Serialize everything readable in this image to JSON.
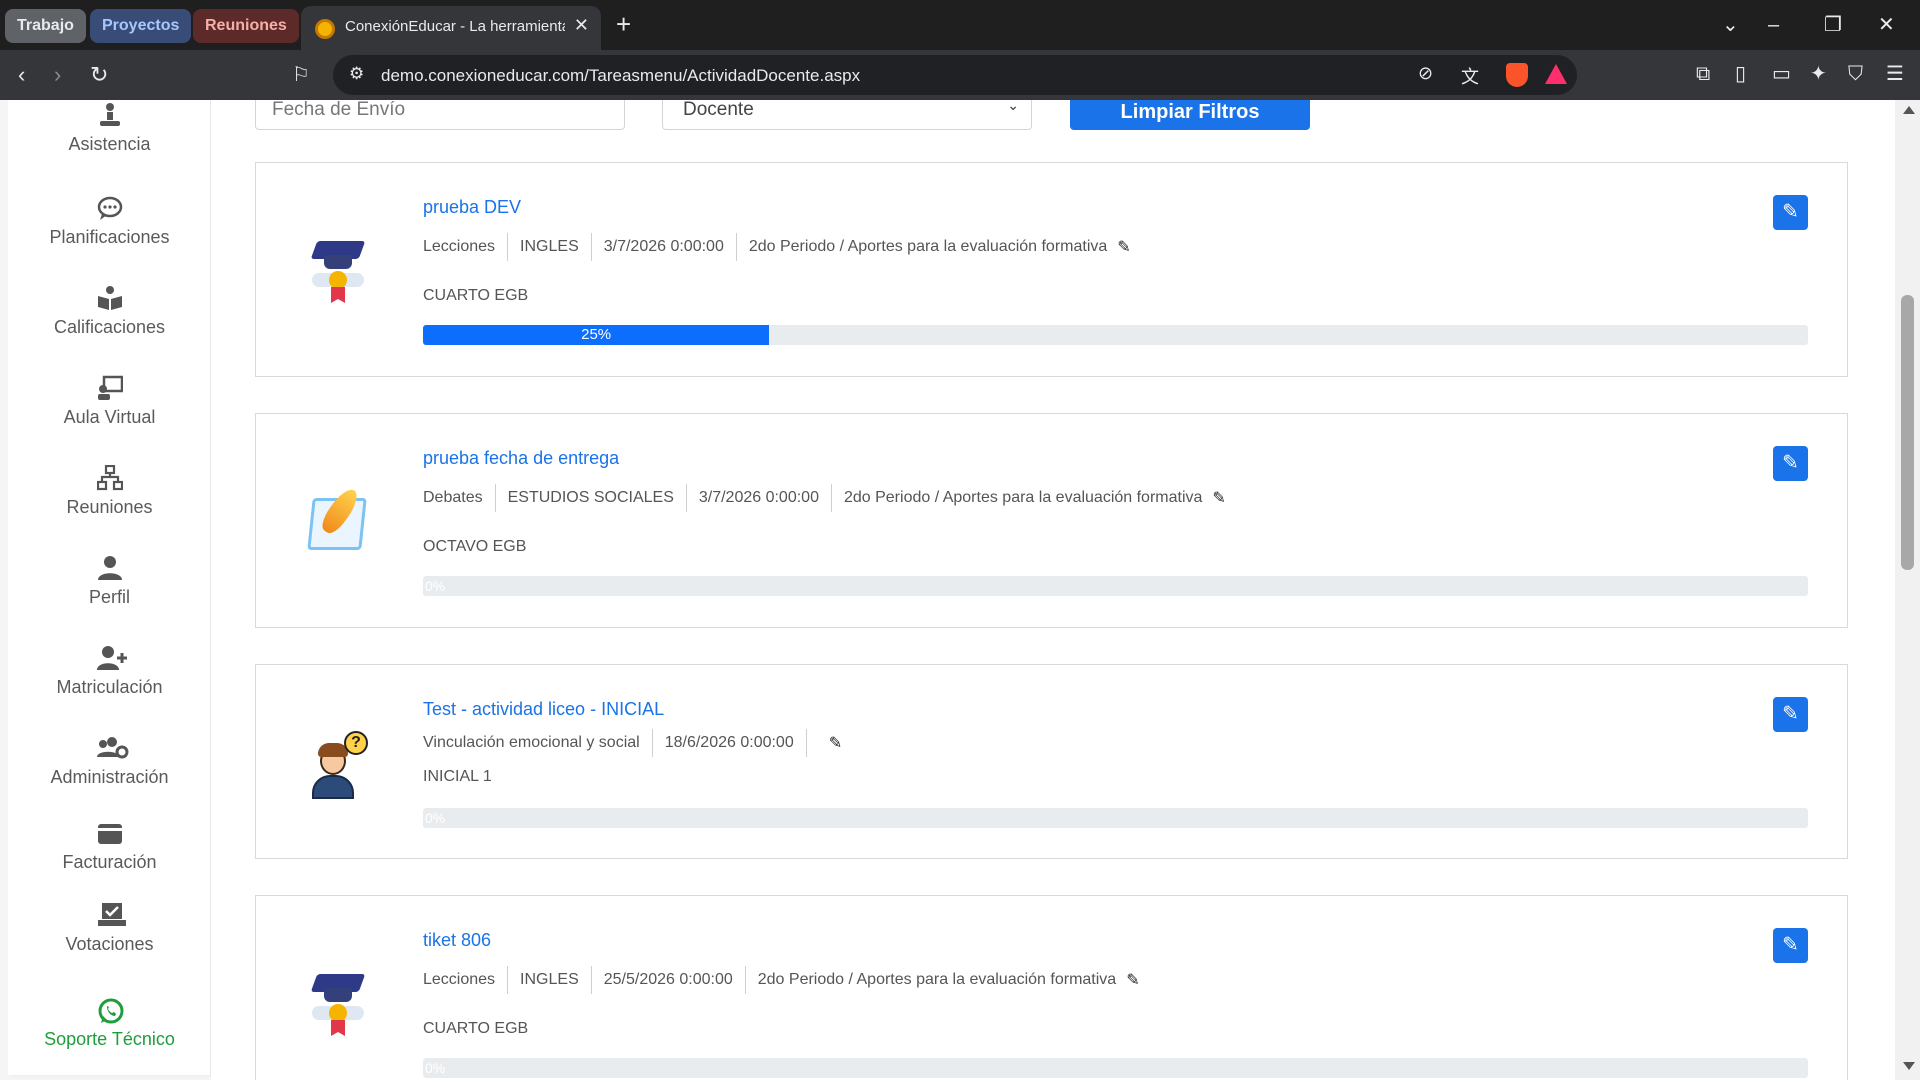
{
  "browser": {
    "tab_groups": [
      "Trabajo",
      "Proyectos",
      "Reuniones"
    ],
    "active_tab_title": "ConexiónEducar - La herramienta",
    "url": "demo.conexioneducar.com/Tareasmenu/ActividadDocente.aspx"
  },
  "sidebar": {
    "items": [
      {
        "label": "Asistencia",
        "icon": "user-stand-icon"
      },
      {
        "label": "Planificaciones",
        "icon": "chat-bubble-icon"
      },
      {
        "label": "Calificaciones",
        "icon": "book-reader-icon"
      },
      {
        "label": "Aula Virtual",
        "icon": "chalkboard-teacher-icon"
      },
      {
        "label": "Reuniones",
        "icon": "network-icon"
      },
      {
        "label": "Perfil",
        "icon": "user-icon"
      },
      {
        "label": "Matriculación",
        "icon": "user-plus-icon"
      },
      {
        "label": "Administración",
        "icon": "users-cog-icon"
      },
      {
        "label": "Facturación",
        "icon": "wallet-icon"
      },
      {
        "label": "Votaciones",
        "icon": "vote-box-icon"
      },
      {
        "label": "Soporte Técnico",
        "icon": "whatsapp-icon"
      }
    ]
  },
  "filters": {
    "date_placeholder": "Fecha de Envío",
    "select_value": "Docente",
    "clear_label": "Limpiar Filtros"
  },
  "cards": [
    {
      "title": "prueba DEV",
      "type": "Lecciones",
      "subject": "INGLES",
      "date": "3/7/2026 0:00:00",
      "period": "2do Periodo / Aportes para la evaluación formativa",
      "grade": "CUARTO EGB",
      "progress": 25,
      "progress_label": "25%",
      "icon": "graduation-cap-icon"
    },
    {
      "title": "prueba fecha de entrega",
      "type": "Debates",
      "subject": "ESTUDIOS SOCIALES",
      "date": "3/7/2026 0:00:00",
      "period": "2do Periodo / Aportes para la evaluación formativa",
      "grade": "OCTAVO EGB",
      "progress": 0,
      "progress_label": "0%",
      "icon": "quill-paper-icon"
    },
    {
      "title": "Test - actividad liceo - INICIAL",
      "type": "Vinculación emocional y social",
      "date": "18/6/2026 0:00:00",
      "period": "",
      "grade": "INICIAL 1",
      "progress": 0,
      "progress_label": "0%",
      "icon": "student-question-icon"
    },
    {
      "title": "tiket 806",
      "type": "Lecciones",
      "subject": "INGLES",
      "date": "25/5/2026 0:00:00",
      "period": "2do Periodo / Aportes para la evaluación formativa",
      "grade": "CUARTO EGB",
      "progress": 0,
      "progress_label": "0%",
      "icon": "graduation-cap-icon"
    }
  ],
  "colors": {
    "accent": "#1a73e8",
    "progress": "#0d6efd",
    "support": "#1e9e3a"
  }
}
